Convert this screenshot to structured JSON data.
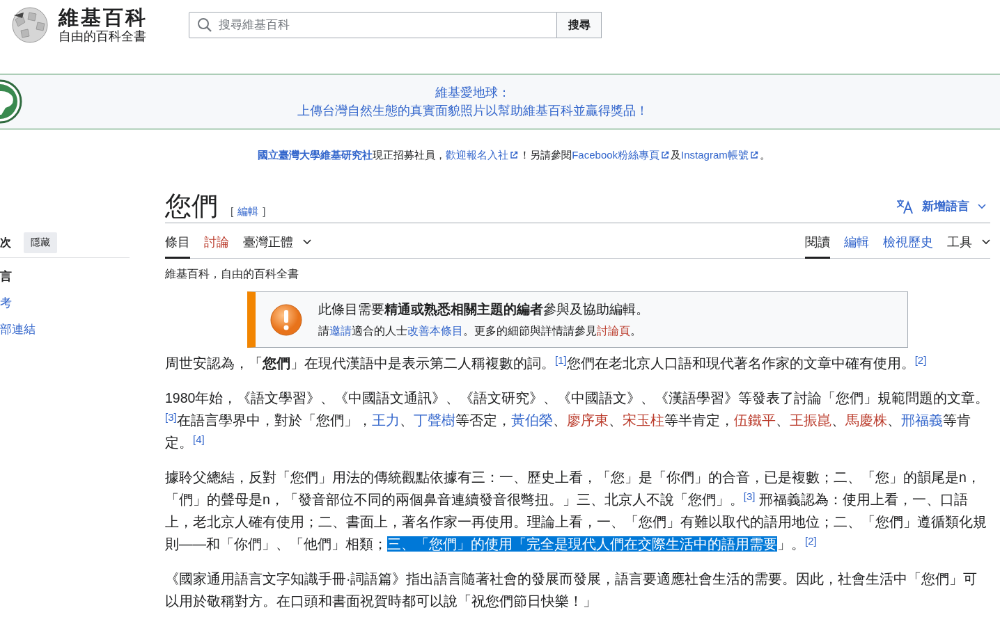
{
  "header": {
    "logo_title": "維基百科",
    "logo_subtitle": "自由的百科全書",
    "search": {
      "placeholder": "搜尋維基百科"
    },
    "search_button": "搜尋"
  },
  "banner": {
    "lines": [
      "維基愛地球：",
      "上傳台灣自然生態的真實面貌照片以幫助維基百科並贏得獎品！"
    ]
  },
  "notice": [
    {
      "kind": "strong-link",
      "text": "國立臺灣大學維基研究社"
    },
    {
      "kind": "text",
      "text": "現正招募社員，"
    },
    {
      "kind": "extlink",
      "text": "歡迎報名入社"
    },
    {
      "kind": "text",
      "text": "！另請參閱"
    },
    {
      "kind": "extlink",
      "text": "Facebook粉絲專頁"
    },
    {
      "kind": "text",
      "text": "及"
    },
    {
      "kind": "extlink",
      "text": "Instagram帳號"
    },
    {
      "kind": "text",
      "text": "。"
    }
  ],
  "sidebar": {
    "title": "次",
    "hide_button": "隱藏",
    "items": [
      {
        "label": "言",
        "selected": true
      },
      {
        "label": "考",
        "selected": false
      },
      {
        "label": "部連結",
        "selected": false
      }
    ]
  },
  "page": {
    "title": "您們",
    "edit_link": "編輯",
    "edit_brackets": [
      "[",
      "]"
    ],
    "language_button": "新增語言",
    "left_tabs": [
      {
        "label": "條目",
        "kind": "tab",
        "selected": true
      },
      {
        "label": "討論",
        "kind": "redlink",
        "selected": false
      },
      {
        "label": "臺灣正體",
        "kind": "menu",
        "selected": false
      }
    ],
    "right_tabs": [
      {
        "label": "閱讀",
        "kind": "tab",
        "selected": true
      },
      {
        "label": "編輯",
        "kind": "link",
        "selected": false
      },
      {
        "label": "檢視歷史",
        "kind": "link",
        "selected": false
      },
      {
        "label": "工具",
        "kind": "menu",
        "selected": false
      }
    ],
    "tagline": "維基百科，自由的百科全書",
    "message_box": {
      "line1": [
        {
          "kind": "text",
          "text": "此條目需要"
        },
        {
          "kind": "bold",
          "text": "精通或熟悉相關主題的編者"
        },
        {
          "kind": "text",
          "text": "參與及協助編輯。"
        }
      ],
      "line2": [
        {
          "kind": "text",
          "text": "請"
        },
        {
          "kind": "link",
          "text": "邀請"
        },
        {
          "kind": "text",
          "text": "適合的人士"
        },
        {
          "kind": "link",
          "text": "改善本條目"
        },
        {
          "kind": "text",
          "text": "。更多的細節與詳情請參見"
        },
        {
          "kind": "redlink",
          "text": "討論頁"
        },
        {
          "kind": "text",
          "text": "。"
        }
      ]
    },
    "paragraphs": [
      [
        {
          "kind": "text",
          "text": "周世安認為，「"
        },
        {
          "kind": "bold",
          "text": "您們"
        },
        {
          "kind": "text",
          "text": "」在現代漢語中是表示第二人稱複數的詞。"
        },
        {
          "kind": "ref",
          "text": "[1]"
        },
        {
          "kind": "text",
          "text": "您們在老北京人口語和現代著名作家的文章中確有使用。"
        },
        {
          "kind": "ref",
          "text": "[2]"
        }
      ],
      [
        {
          "kind": "text",
          "text": "1980年始，《語文學習》、《中國語文通訊》、《語文研究》、《中國語文》、《漢語學習》等發表了討論「您們」規範問題的文章。"
        },
        {
          "kind": "ref",
          "text": "[3]"
        },
        {
          "kind": "text",
          "text": "在語言學界中，對於「您們」，"
        },
        {
          "kind": "link",
          "text": "王力"
        },
        {
          "kind": "text",
          "text": "、"
        },
        {
          "kind": "link",
          "text": "丁聲樹"
        },
        {
          "kind": "text",
          "text": "等否定，"
        },
        {
          "kind": "link",
          "text": "黃伯榮"
        },
        {
          "kind": "text",
          "text": "、"
        },
        {
          "kind": "redlink",
          "text": "廖序東"
        },
        {
          "kind": "text",
          "text": "、"
        },
        {
          "kind": "redlink",
          "text": "宋玉柱"
        },
        {
          "kind": "text",
          "text": "等半肯定，"
        },
        {
          "kind": "redlink",
          "text": "伍鐵平"
        },
        {
          "kind": "text",
          "text": "、"
        },
        {
          "kind": "redlink",
          "text": "王振崑"
        },
        {
          "kind": "text",
          "text": "、"
        },
        {
          "kind": "redlink",
          "text": "馬慶株"
        },
        {
          "kind": "text",
          "text": "、"
        },
        {
          "kind": "link",
          "text": "邢福義"
        },
        {
          "kind": "text",
          "text": "等肯定。"
        },
        {
          "kind": "ref",
          "text": "[4]"
        }
      ],
      [
        {
          "kind": "text",
          "text": "據聆父總結，反對「您們」用法的傳統觀點依據有三：一、歷史上看，「您」是「你們」的合音，已是複數；二、「您」的韻尾是n，「們」的聲母是n，「發音部位不同的兩個鼻音連續發音很彆扭。」三、北京人不說「您們」。"
        },
        {
          "kind": "ref",
          "text": "[3]"
        },
        {
          "kind": "text",
          "text": " 邢福義認為：使用上看，一、口語上，老北京人確有使用；二、書面上，著名作家一再使用。理論上看，一、「您們」有難以取代的語用地位；二、「您們」遵循類化規則——和「你們」、「他們」相類；"
        },
        {
          "kind": "selected",
          "text": "三、「您們」的使用「完全是現代人們在交際生活中的語用需要"
        },
        {
          "kind": "text",
          "text": "」。"
        },
        {
          "kind": "ref",
          "text": "[2]"
        }
      ],
      [
        {
          "kind": "text",
          "text": "《國家通用語言文字知識手冊·詞語篇》指出語言隨著社會的發展而發展，語言要適應社會生活的需要。因此，社會生活中「您們」可以用於敬稱對方。在口頭和書面祝賀時都可以說「祝您們節日快樂！」"
        }
      ]
    ]
  }
}
